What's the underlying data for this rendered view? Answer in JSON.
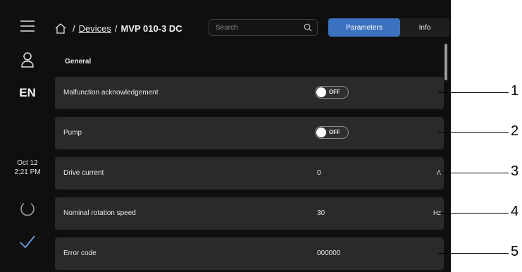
{
  "breadcrumb": {
    "sep1": "/",
    "devices": "Devices",
    "sep2": "/",
    "device": "MVP 010-3 DC"
  },
  "search": {
    "placeholder": "Search"
  },
  "tabs": [
    {
      "label": "Parameters"
    },
    {
      "label": "Info"
    }
  ],
  "sidebar": {
    "language": "EN",
    "date": "Oct 12",
    "time": "2:21 PM"
  },
  "section": {
    "title": "General"
  },
  "rows": [
    {
      "label": "Malfunction acknowledgement",
      "toggle": "OFF"
    },
    {
      "label": "Pump",
      "toggle": "OFF"
    },
    {
      "label": "Drive current",
      "value": "0",
      "unit": "A"
    },
    {
      "label": "Nominal rotation speed",
      "value": "30",
      "unit": "Hz"
    },
    {
      "label": "Error code",
      "value": "000000"
    }
  ],
  "callouts": [
    "1",
    "2",
    "3",
    "4",
    "5"
  ],
  "colors": {
    "background": "#0f0f0f",
    "row": "#2a2a2a",
    "accent": "#3b72bf"
  }
}
